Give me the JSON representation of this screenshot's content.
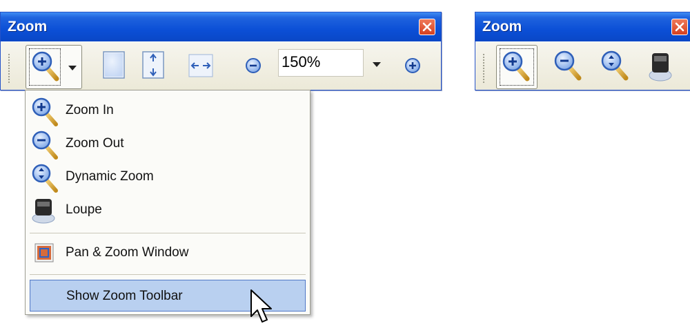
{
  "left_window": {
    "title": "Zoom",
    "zoom_value": "150%"
  },
  "right_window": {
    "title": "Zoom"
  },
  "menu": {
    "items": [
      {
        "label": "Zoom In",
        "icon": "zoom-in-icon"
      },
      {
        "label": "Zoom Out",
        "icon": "zoom-out-icon"
      },
      {
        "label": "Dynamic Zoom",
        "icon": "dynamic-zoom-icon"
      },
      {
        "label": "Loupe",
        "icon": "loupe-icon"
      },
      {
        "label": "Pan & Zoom Window",
        "icon": "pan-zoom-window-icon"
      },
      {
        "label": "Show Zoom Toolbar",
        "highlighted": true
      }
    ]
  },
  "colors": {
    "titlebar": "#0a4fd6",
    "highlight": "#b9d0f0",
    "toolbar_bg": "#ece9d8"
  }
}
